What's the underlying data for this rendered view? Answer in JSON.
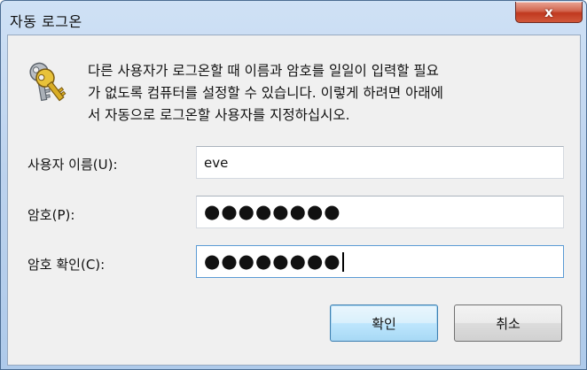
{
  "window": {
    "title": "자동 로그온",
    "close_glyph": "x"
  },
  "icon": {
    "name": "keys-icon"
  },
  "message": "다른 사용자가 로그온할 때 이름과 암호를 일일이 입력할 필요가 없도록 컴퓨터를 설정할 수 있습니다. 이렇게 하려면 아래에서 자동으로 로그온할 사용자를 지정하십시오.",
  "message_lines": [
    "다른 사용자가 로그온할 때 이름과 암호를 일일이 입력할 필요",
    "가 없도록 컴퓨터를 설정할 수 있습니다. 이렇게 하려면 아래에",
    "서 자동으로 로그온할 사용자를 지정하십시오."
  ],
  "fields": {
    "username": {
      "label": "사용자 이름(U):",
      "value": "eve"
    },
    "password": {
      "label": "암호(P):",
      "value": "●●●●●●●●"
    },
    "confirm": {
      "label": "암호 확인(C):",
      "value": "●●●●●●●●"
    }
  },
  "buttons": {
    "ok": "확인",
    "cancel": "취소"
  }
}
